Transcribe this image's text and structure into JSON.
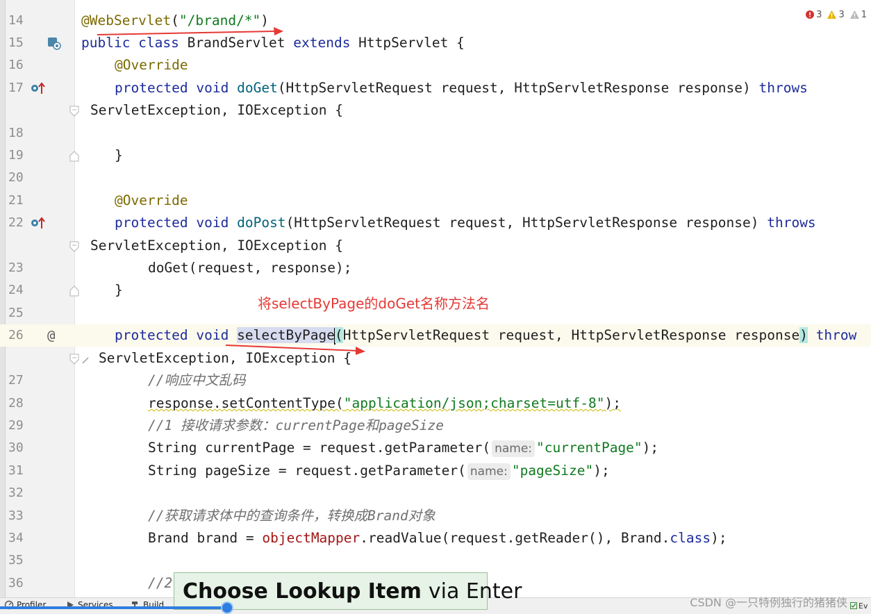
{
  "inspection": {
    "errors": "3",
    "warnings": "3",
    "weak_warnings": "1"
  },
  "lines": {
    "l14": {
      "num": "14",
      "ann": "@WebServlet",
      "p1": "(",
      "str": "\"/brand/*\"",
      "p2": ")"
    },
    "l15": {
      "num": "15",
      "kw1": "public class ",
      "t1": "BrandServlet ",
      "kw2": "extends ",
      "t2": "HttpServlet {"
    },
    "l16": {
      "num": "16",
      "ann": "@Override"
    },
    "l17": {
      "num": "17",
      "kw1": "protected void ",
      "fn": "doGet",
      "t1": "(HttpServletRequest request, HttpServletResponse response) ",
      "kw2": "throws"
    },
    "l17b": {
      "t1": "ServletException, IOException {"
    },
    "l18": {
      "num": "18"
    },
    "l19": {
      "num": "19",
      "t1": "}"
    },
    "l20": {
      "num": "20"
    },
    "l21": {
      "num": "21",
      "ann": "@Override"
    },
    "l22": {
      "num": "22",
      "kw1": "protected void ",
      "fn": "doPost",
      "t1": "(HttpServletRequest request, HttpServletResponse response) ",
      "kw2": "throws"
    },
    "l22b": {
      "t1": "ServletException, IOException {"
    },
    "l23": {
      "num": "23",
      "t1": "doGet(request, response);"
    },
    "l24": {
      "num": "24",
      "t1": "}"
    },
    "l25": {
      "num": "25"
    },
    "l26": {
      "num": "26",
      "gutter": "@",
      "kw1": "protected void ",
      "sel": "selectByPage",
      "p1": "(",
      "t1": "HttpServletRequest request, HttpServletResponse response",
      "p2": ")",
      "kw2": " throw"
    },
    "l26b": {
      "t1": "ServletException, IOException {"
    },
    "l27": {
      "num": "27",
      "cmt": "//响应中文乱码"
    },
    "l28": {
      "num": "28",
      "t1": "response.setContentType(",
      "str": "\"application/json;charset=utf-8\"",
      "t2": ");"
    },
    "l29": {
      "num": "29",
      "cmt": "//1 接收请求参数：currentPage和pageSize"
    },
    "l30": {
      "num": "30",
      "t1": "String currentPage = request.getParameter(",
      "hint": "name:",
      "str": "\"currentPage\"",
      "t2": ");"
    },
    "l31": {
      "num": "31",
      "t1": "String pageSize = request.getParameter(",
      "hint": "name:",
      "str": "\"pageSize\"",
      "t2": ");"
    },
    "l32": {
      "num": "32"
    },
    "l33": {
      "num": "33",
      "cmt": "//获取请求体中的查询条件，转换成Brand对象"
    },
    "l34": {
      "num": "34",
      "t1": "Brand brand = ",
      "fld": "objectMapper",
      "t2": ".readValue(request.getReader(), Brand.",
      "kw": "class",
      "t3": ");"
    },
    "l35": {
      "num": "35"
    },
    "l36": {
      "num": "36",
      "cmt": "//2"
    }
  },
  "annotation_text": "将selectByPage的doGet名称方法名",
  "tooltip": {
    "bold": "Choose Lookup Item",
    "rest": "via Enter"
  },
  "bottom_tabs": {
    "profiler": "Profiler",
    "services": "Services",
    "build": "Build"
  },
  "watermark": "CSDN @一只特例独行的猪猪侠",
  "right_edge_label": "Ev",
  "colors": {
    "annotation_red": "#e53935",
    "keyword": "#1d2b9b",
    "string": "#117a20",
    "annotation": "#7c6a00",
    "tooltip_bg": "#e6f3e6"
  }
}
